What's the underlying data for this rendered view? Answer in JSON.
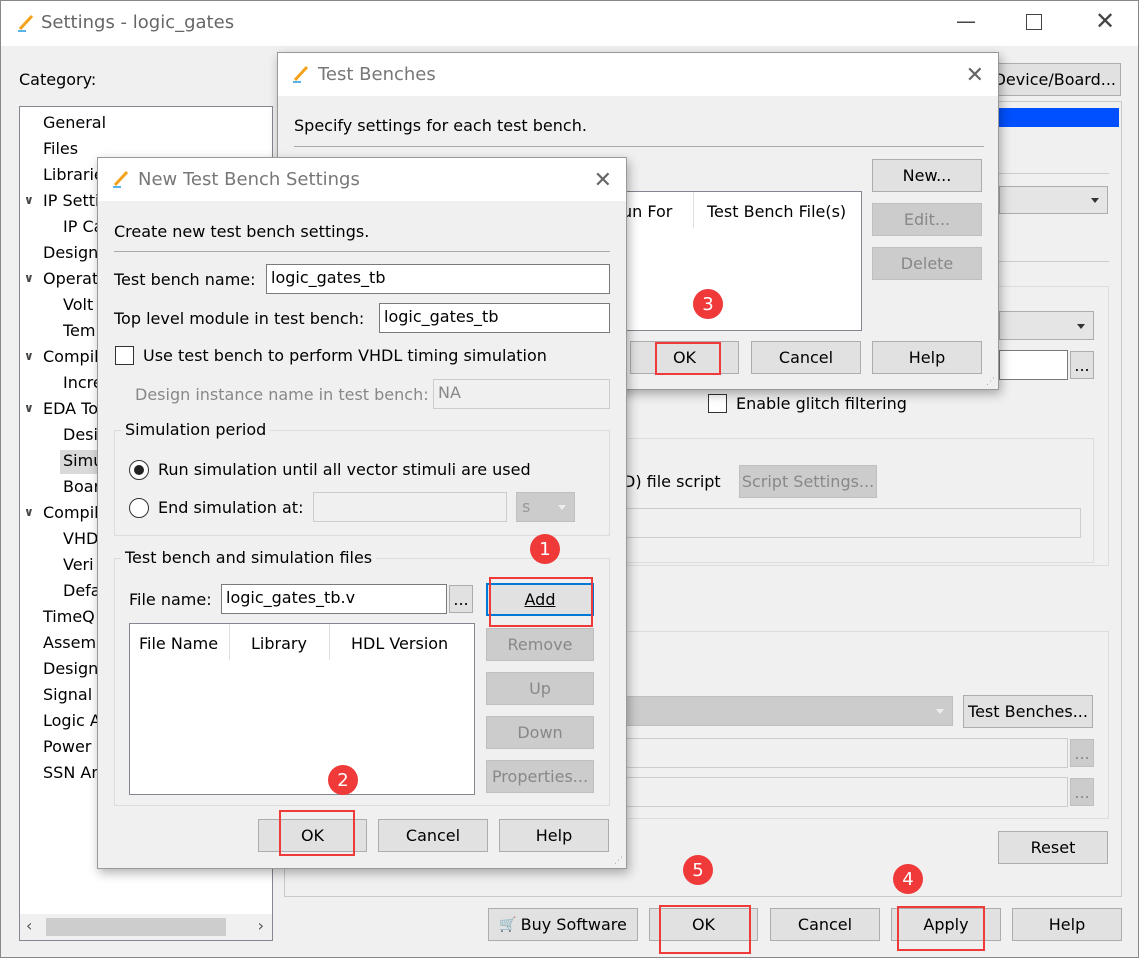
{
  "window": {
    "title": "Settings - logic_gates",
    "category_label": "Category:",
    "device_board_button": "Device/Board..."
  },
  "sidebar": {
    "items": [
      {
        "label": "General",
        "level": 0
      },
      {
        "label": "Files",
        "level": 0
      },
      {
        "label": "Librarie",
        "level": 0
      },
      {
        "label": "IP Setti",
        "level": 0,
        "expanded": true
      },
      {
        "label": "IP Ca",
        "level": 1
      },
      {
        "label": "Design",
        "level": 0
      },
      {
        "label": "Operat",
        "level": 0,
        "expanded": true
      },
      {
        "label": "Volt",
        "level": 1
      },
      {
        "label": "Tem",
        "level": 1
      },
      {
        "label": "Compil",
        "level": 0,
        "expanded": true
      },
      {
        "label": "Incre",
        "level": 1
      },
      {
        "label": "EDA To",
        "level": 0,
        "expanded": true
      },
      {
        "label": "Desig",
        "level": 1
      },
      {
        "label": "Simu",
        "level": 1,
        "selected": true
      },
      {
        "label": "Boar",
        "level": 1
      },
      {
        "label": "Compil",
        "level": 0,
        "expanded": true
      },
      {
        "label": "VHD",
        "level": 1
      },
      {
        "label": "Veri",
        "level": 1
      },
      {
        "label": "Defa",
        "level": 1
      },
      {
        "label": "TimeQ",
        "level": 0
      },
      {
        "label": "Assem",
        "level": 0
      },
      {
        "label": "Design",
        "level": 0
      },
      {
        "label": "Signal T",
        "level": 0
      },
      {
        "label": "Logic A",
        "level": 0
      },
      {
        "label": "Power",
        "level": 0
      },
      {
        "label": "SSN An",
        "level": 0
      }
    ]
  },
  "main": {
    "glitch_label": "Enable glitch filtering",
    "script_label": "D) file script",
    "script_settings_button": "Script Settings...",
    "test_benches_button": "Test Benches...",
    "browse": "...",
    "reset_button": "Reset"
  },
  "footer": {
    "buy_software": "Buy Software",
    "ok": "OK",
    "cancel": "Cancel",
    "apply": "Apply",
    "help": "Help"
  },
  "test_benches_dialog": {
    "title": "Test Benches",
    "description": "Specify settings for each test bench.",
    "columns": [
      "un For",
      "Test Bench File(s)"
    ],
    "new_button": "New...",
    "edit_button": "Edit...",
    "delete_button": "Delete",
    "ok": "OK",
    "cancel": "Cancel",
    "help": "Help"
  },
  "new_tb_dialog": {
    "title": "New Test Bench Settings",
    "description": "Create new test bench settings.",
    "tb_name_label": "Test bench name:",
    "tb_name_value": "logic_gates_tb",
    "top_module_label": "Top level module in test bench:",
    "top_module_value": "logic_gates_tb",
    "vhdl_timing_label": "Use test bench to perform VHDL timing simulation",
    "vhdl_timing_checked": false,
    "instance_label": "Design instance name in test bench:",
    "instance_value": "NA",
    "sim_period_label": "Simulation period",
    "run_all_label": "Run simulation until all vector stimuli are used",
    "run_all_selected": true,
    "end_at_label": "End simulation at:",
    "end_at_value": "",
    "unit": "s",
    "files_group_label": "Test bench and simulation files",
    "file_name_label": "File name:",
    "file_name_value": "logic_gates_tb.v",
    "browse": "...",
    "columns": [
      "File Name",
      "Library",
      "HDL Version"
    ],
    "add": "Add",
    "remove": "Remove",
    "up": "Up",
    "down": "Down",
    "properties": "Properties...",
    "ok": "OK",
    "cancel": "Cancel",
    "help": "Help"
  },
  "annotations": [
    "1",
    "2",
    "3",
    "4",
    "5"
  ],
  "colors": {
    "annotation": "#f03a3a",
    "selection": "#0050ff",
    "focus": "#0078d7"
  }
}
